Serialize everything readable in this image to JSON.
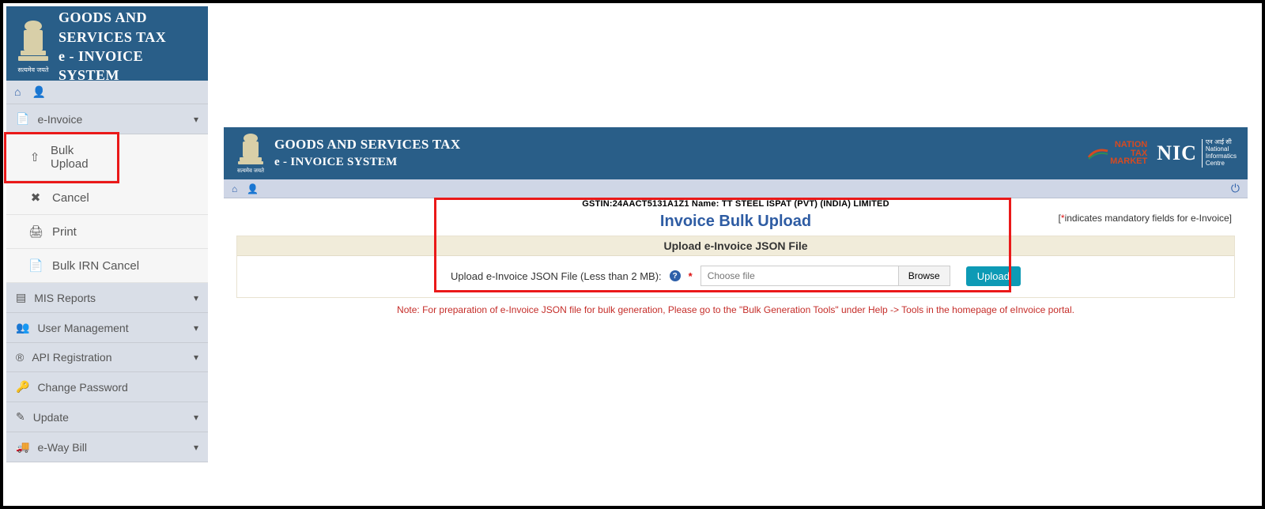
{
  "app": {
    "title_line1": "GOODS AND SERVICES TAX",
    "title_line2": "e - INVOICE SYSTEM",
    "emblem_caption": "सत्यमेव जयते"
  },
  "sidebar": {
    "cat_einvoice": "e-Invoice",
    "sub_bulk_upload": "Bulk Upload",
    "sub_cancel": "Cancel",
    "sub_print": "Print",
    "sub_bulk_irn_cancel": "Bulk IRN Cancel",
    "cat_mis": "MIS Reports",
    "cat_user_mgmt": "User Management",
    "cat_api_reg": "API Registration",
    "cat_change_pw": "Change Password",
    "cat_update": "Update",
    "cat_eway": "e-Way Bill"
  },
  "page": {
    "header_line1": "GOODS AND SERVICES TAX",
    "header_line2": "e - INVOICE SYSTEM",
    "ntm_l1": "NATION",
    "ntm_l2": "TAX",
    "ntm_l3": "MARKET",
    "nic_big": "NIC",
    "nic_small1": "एन आई सी",
    "nic_small2": "National",
    "nic_small3": "Informatics",
    "nic_small4": "Centre",
    "acct_line": "GSTIN:24AACT5131A1Z1   Name: TT STEEL ISPAT (PVT) (INDIA) LIMITED",
    "title": "Invoice Bulk Upload",
    "mandatory_note_pre": "[",
    "mandatory_note_star": "*",
    "mandatory_note_post": "indicates mandatory fields for e-Invoice]",
    "panel_head": "Upload e-Invoice JSON File",
    "upload_label": "Upload e-Invoice JSON File (Less than 2 MB):",
    "file_placeholder": "Choose file",
    "browse": "Browse",
    "upload": "Upload",
    "note": "Note: For preparation of e-Invoice JSON file for bulk generation, Please go to the \"Bulk Generation Tools\" under Help -> Tools in the homepage of eInvoice portal."
  }
}
